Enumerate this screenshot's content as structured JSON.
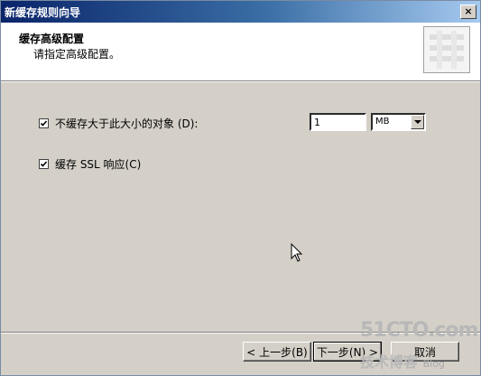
{
  "window": {
    "title": "新缓存规则向导",
    "close_glyph": "×"
  },
  "header": {
    "title": "缓存高级配置",
    "subtitle": "请指定高级配置。"
  },
  "options": {
    "max_size": {
      "checked": true,
      "label": "不缓存大于此大小的对象 (D):",
      "value": "1",
      "unit": "MB"
    },
    "cache_ssl": {
      "checked": true,
      "label": "缓存 SSL 响应(C)"
    }
  },
  "buttons": {
    "back": "< 上一步(B)",
    "next": "下一步(N) >",
    "cancel": "取消"
  },
  "watermark": {
    "site": "51CTO.com",
    "tagline": "技术博客",
    "blog": "Blog"
  }
}
